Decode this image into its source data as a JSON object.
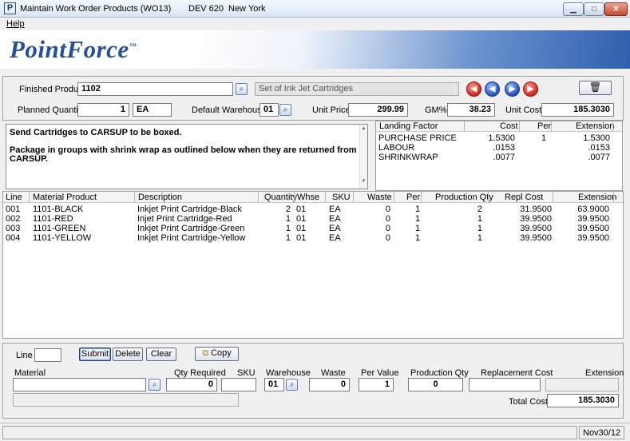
{
  "window": {
    "app_icon": "P",
    "title": "Maintain Work Order Products (WO13)",
    "environment": "DEV 620",
    "location": "New York",
    "minimize_icon": "minimize-icon",
    "maximize_icon": "maximize-icon",
    "close_icon": "close-icon"
  },
  "menu": {
    "help": "Help"
  },
  "banner": {
    "logo": "PointForce",
    "trademark": "™"
  },
  "header": {
    "finished_product_label": "Finished Product",
    "finished_product_value": "1102",
    "product_description": "Set of Ink Jet Cartridges",
    "planned_quantity_label": "Planned Quantity",
    "planned_quantity_value": "1",
    "planned_uom": "EA",
    "default_warehouse_label": "Default Warehouse",
    "default_warehouse_value": "01",
    "unit_price_label": "Unit Price",
    "unit_price_value": "299.99",
    "gm_label": "GM%",
    "gm_value": "38.23",
    "unit_cost_label": "Unit Cost",
    "unit_cost_value": "185.3030"
  },
  "notes": {
    "line1": "Send Cartridges to CARSUP to be boxed.",
    "line2": "Package in groups with shrink wrap as outlined below when they are returned from",
    "line3": "CARSUP."
  },
  "landing": {
    "headers": {
      "factor": "Landing Factor",
      "cost": "Cost",
      "per": "Per",
      "extension": "Extension"
    },
    "rows": [
      {
        "factor": "PURCHASE PRICE",
        "cost": "1.5300",
        "per": "1",
        "extension": "1.5300"
      },
      {
        "factor": "LABOUR",
        "cost": ".0153",
        "per": "",
        "extension": ".0153"
      },
      {
        "factor": "SHRINKWRAP",
        "cost": ".0077",
        "per": "",
        "extension": ".0077"
      }
    ]
  },
  "grid": {
    "headers": {
      "line": "Line",
      "material": "Material Product",
      "description": "Description",
      "quantity": "Quantity",
      "whse": "Whse",
      "sku": "SKU",
      "waste": "Waste",
      "per": "Per",
      "production_qty": "Production Qty",
      "repl_cost": "Repl Cost",
      "extension": "Extension"
    },
    "rows": [
      {
        "line": "001",
        "material": "1101-BLACK",
        "description": "Inkjet Print Cartridge-Black",
        "quantity": "2",
        "whse": "01",
        "sku": "EA",
        "waste": "0",
        "per": "1",
        "production_qty": "2",
        "repl_cost": "31.9500",
        "extension": "63.9000"
      },
      {
        "line": "002",
        "material": "1101-RED",
        "description": "Injet Print Cartridge-Red",
        "quantity": "1",
        "whse": "01",
        "sku": "EA",
        "waste": "0",
        "per": "1",
        "production_qty": "1",
        "repl_cost": "39.9500",
        "extension": "39.9500"
      },
      {
        "line": "003",
        "material": "1101-GREEN",
        "description": "Inkjet Print Cartridge-Green",
        "quantity": "1",
        "whse": "01",
        "sku": "EA",
        "waste": "0",
        "per": "1",
        "production_qty": "1",
        "repl_cost": "39.9500",
        "extension": "39.9500"
      },
      {
        "line": "004",
        "material": "1101-YELLOW",
        "description": "Inkjet Print Cartridge-Yellow",
        "quantity": "1",
        "whse": "01",
        "sku": "EA",
        "waste": "0",
        "per": "1",
        "production_qty": "1",
        "repl_cost": "39.9500",
        "extension": "39.9500"
      }
    ]
  },
  "editor": {
    "line_label": "Line",
    "submit": "Submit",
    "delete": "Delete",
    "clear": "Clear",
    "copy": "Copy",
    "material_label": "Material",
    "qty_required_label": "Qty Required",
    "qty_required_value": "0",
    "sku_label": "SKU",
    "warehouse_label": "Warehouse",
    "warehouse_value": "01",
    "waste_label": "Waste",
    "waste_value": "0",
    "per_value_label": "Per Value",
    "per_value_value": "1",
    "production_qty_label": "Production Qty",
    "production_qty_value": "0",
    "replacement_cost_label": "Replacement Cost",
    "extension_label": "Extension",
    "total_cost_label": "Total Cost",
    "total_cost_value": "185.3030"
  },
  "status": {
    "date": "Nov30/12"
  }
}
